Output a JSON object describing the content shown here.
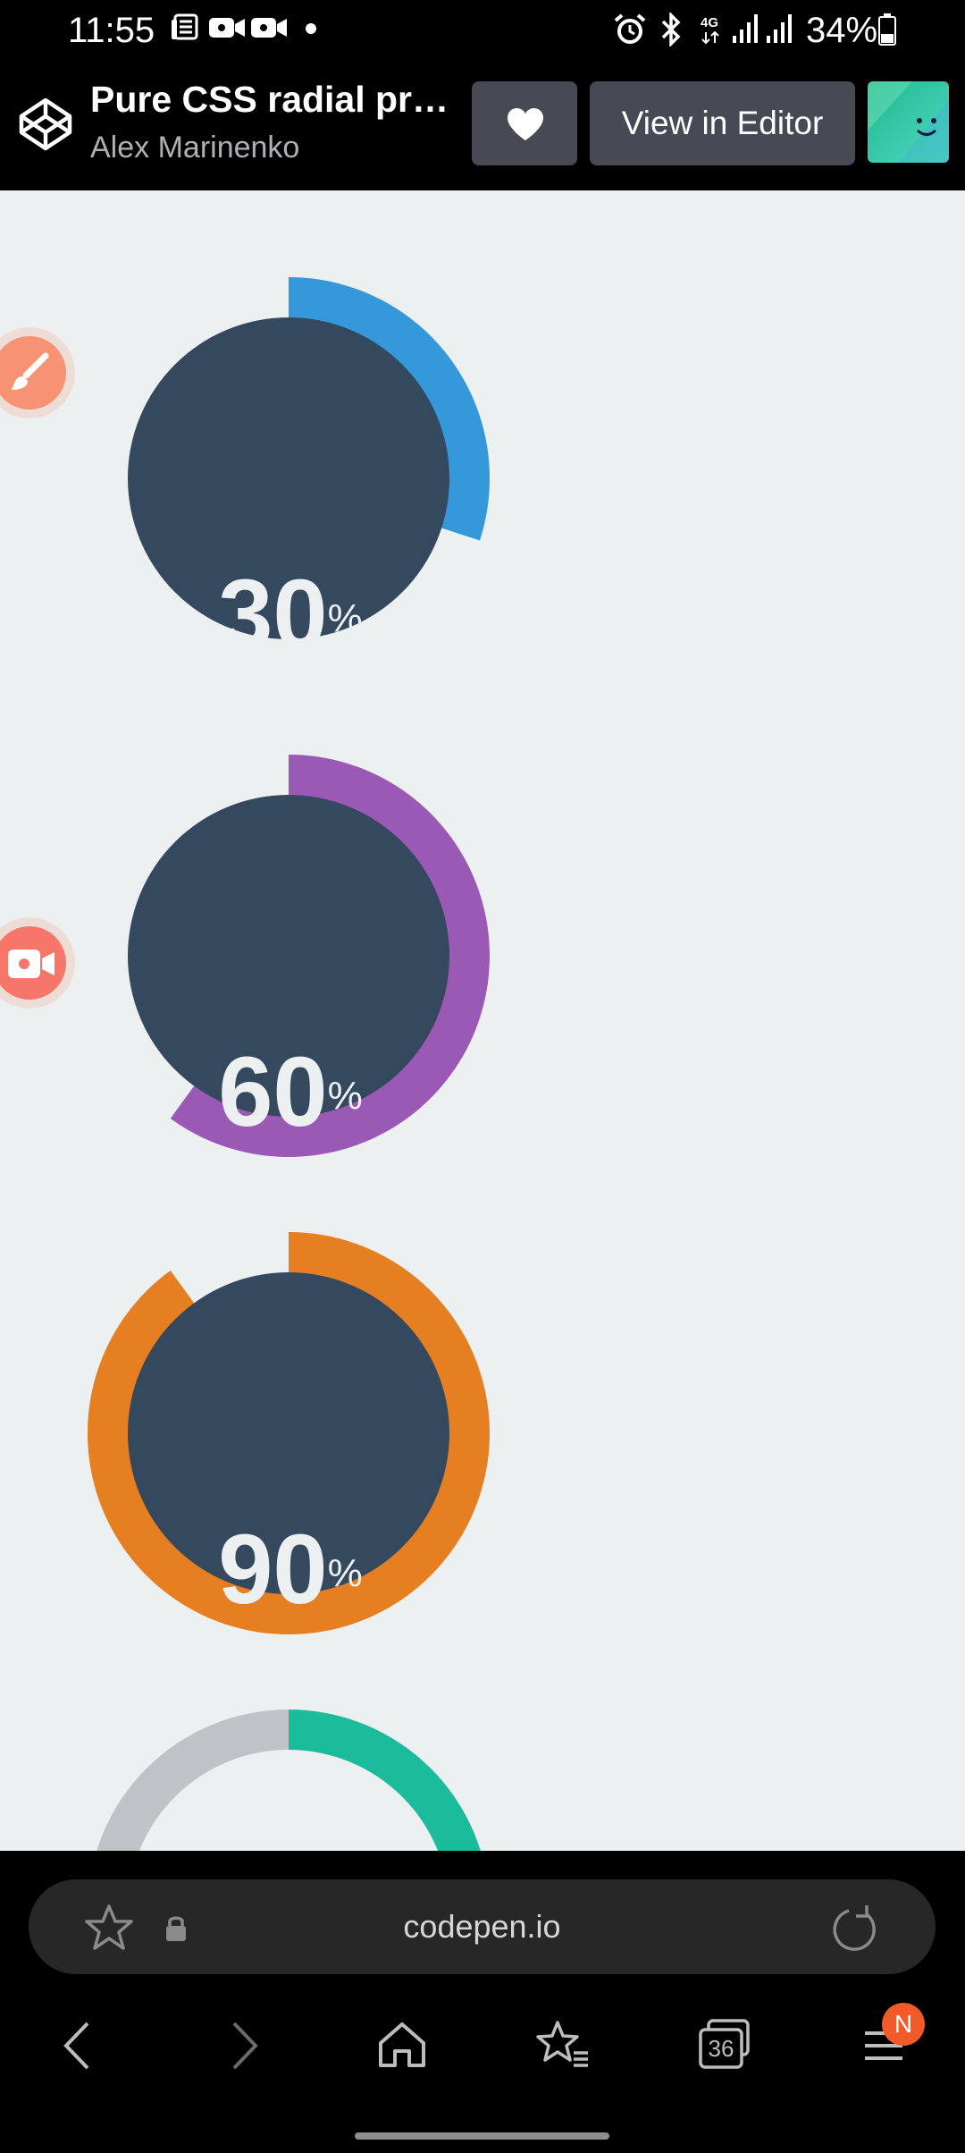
{
  "status_bar": {
    "time": "11:55",
    "battery": "34%",
    "icons": [
      "news-icon",
      "video-call-icon",
      "video-call-icon",
      "dot-icon",
      "alarm-icon",
      "bluetooth-icon",
      "4g-icon",
      "signal-icon",
      "signal-icon",
      "battery-icon"
    ]
  },
  "header": {
    "title": "Pure CSS radial progr...",
    "author": "Alex Marinenko",
    "heart_icon": "heart-icon",
    "view_editor_label": "View in Editor",
    "logo_icon": "codepen-logo-icon"
  },
  "content": {
    "floating_buttons": [
      "brush-icon",
      "video-icon"
    ],
    "progress_items": [
      {
        "value": 30,
        "label": "30",
        "unit": "%",
        "color": "#3498db"
      },
      {
        "value": 60,
        "label": "60",
        "unit": "%",
        "color": "#9b59b6"
      },
      {
        "value": 90,
        "label": "90",
        "unit": "%",
        "color": "#e67e22"
      },
      {
        "value": 50,
        "label": "",
        "unit": "",
        "color": "#1abc9c"
      }
    ],
    "track_color": "#bdc3c7",
    "inner_color": "#34495e"
  },
  "browser": {
    "url": "codepen.io",
    "tab_count": "36",
    "badge": "N",
    "icons": [
      "star-icon",
      "lock-icon",
      "reload-icon",
      "back-icon",
      "forward-icon",
      "home-icon",
      "bookmarks-icon",
      "tabs-icon",
      "menu-icon"
    ]
  }
}
